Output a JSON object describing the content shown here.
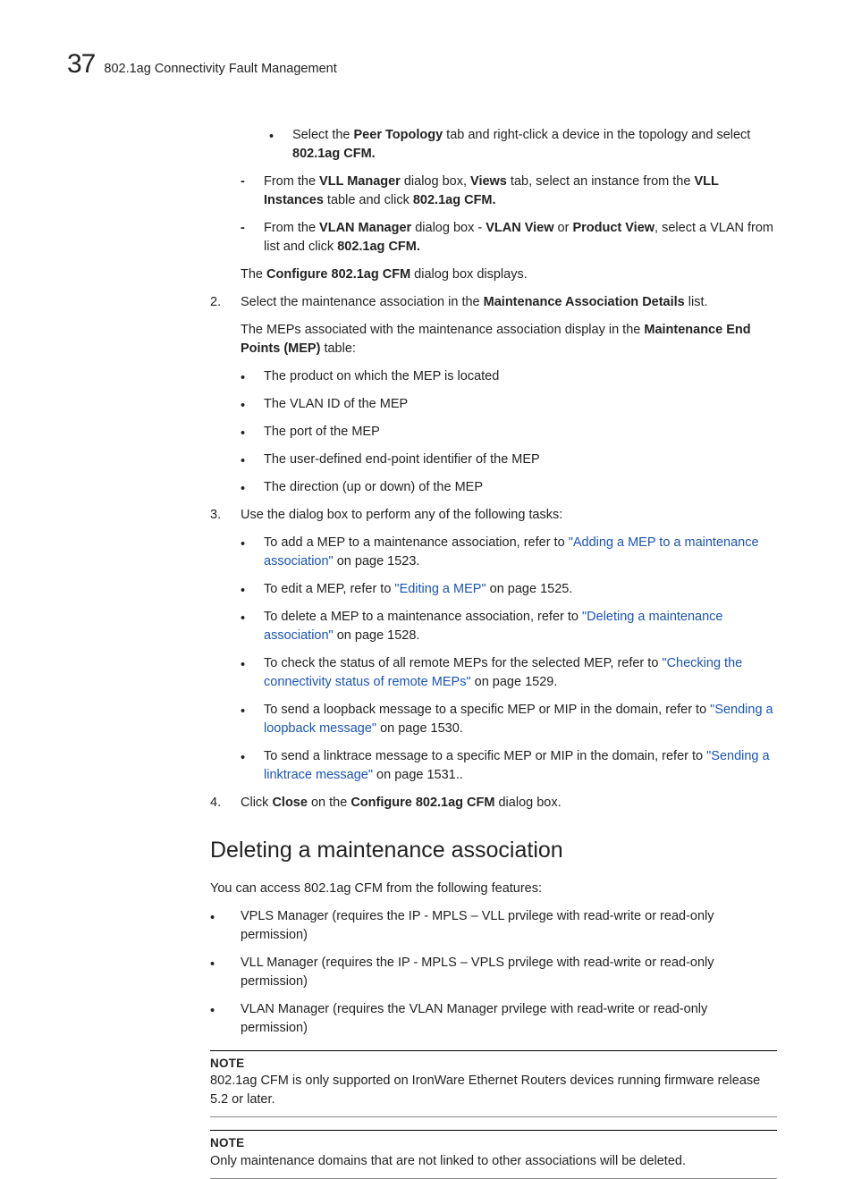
{
  "header": {
    "chapter": "37",
    "title": "802.1ag Connectivity Fault Management"
  },
  "bullet_topology_a": "Select the ",
  "bullet_topology_b": "Peer Topology",
  "bullet_topology_c": " tab and right-click a device in the topology and select ",
  "bullet_topology_d": "802.1ag CFM.",
  "dash_vll_a": "From the ",
  "dash_vll_b": "VLL Manager",
  "dash_vll_c": " dialog box, ",
  "dash_vll_d": "Views",
  "dash_vll_e": " tab, select an instance from the ",
  "dash_vll_f": "VLL Instances",
  "dash_vll_g": " table and click ",
  "dash_vll_h": "802.1ag CFM.",
  "dash_vlan_a": "From the ",
  "dash_vlan_b": "VLAN Manager",
  "dash_vlan_c": " dialog box - ",
  "dash_vlan_d": "VLAN View",
  "dash_vlan_e": " or ",
  "dash_vlan_f": "Product View",
  "dash_vlan_g": ", select a VLAN from list and click ",
  "dash_vlan_h": "802.1ag CFM.",
  "cfg_a": "The ",
  "cfg_b": "Configure 802.1ag CFM",
  "cfg_c": " dialog box displays.",
  "step2_a": "Select the maintenance association in the ",
  "step2_b": "Maintenance Association Details",
  "step2_c": " list.",
  "s2_sub_a": "The MEPs associated with the maintenance association display in the ",
  "s2_sub_b": "Maintenance End Points (MEP)",
  "s2_sub_c": " table:",
  "s2_b1": "The product on which the MEP is located",
  "s2_b2": "The VLAN ID of the MEP",
  "s2_b3": "The port of the MEP",
  "s2_b4": "The user-defined end-point identifier of the MEP",
  "s2_b5": "The direction (up or down) of the MEP",
  "step3": "Use the dialog box to perform any of the following tasks:",
  "s3_i1_a": "To add a MEP to a maintenance association, refer to ",
  "s3_i1_l": "\"Adding a MEP to a maintenance association\"",
  "s3_i1_b": " on page 1523.",
  "s3_i2_a": "To edit a MEP, refer to ",
  "s3_i2_l": "\"Editing a MEP\"",
  "s3_i2_b": " on page 1525.",
  "s3_i3_a": "To delete a MEP to a maintenance association, refer to ",
  "s3_i3_l": "\"Deleting a maintenance association\"",
  "s3_i3_b": " on page 1528.",
  "s3_i4_a": "To check the status of all remote MEPs for the selected MEP, refer to ",
  "s3_i4_l": "\"Checking the connectivity status of remote MEPs\"",
  "s3_i4_b": " on page 1529.",
  "s3_i5_a": "To send a loopback message to a specific MEP or MIP in the domain, refer to ",
  "s3_i5_l": "\"Sending a loopback message\"",
  "s3_i5_b": " on page 1530.",
  "s3_i6_a": "To send a linktrace message to a specific MEP or MIP in the domain, refer to ",
  "s3_i6_l": "\"Sending a linktrace message\"",
  "s3_i6_b": " on page 1531..",
  "step4_a": "Click ",
  "step4_b": "Close",
  "step4_c": " on the ",
  "step4_d": "Configure 802.1ag CFM",
  "step4_e": " dialog box.",
  "h2": "Deleting a maintenance association",
  "h2_intro": "You can access 802.1ag CFM from the following features:",
  "h2_b1": "VPLS Manager (requires the IP - MPLS – VLL prvilege with read-write or read-only permission)",
  "h2_b2": "VLL Manager (requires the IP - MPLS – VPLS prvilege with read-write or read-only permission)",
  "h2_b3": "VLAN Manager (requires the VLAN Manager prvilege with read-write or read-only permission)",
  "note_head": "NOTE",
  "note1": "802.1ag CFM is only supported on IronWare Ethernet Routers devices running firmware release 5.2 or later.",
  "note2": "Only maintenance domains that are not linked to other associations will be deleted.",
  "num2": "2.",
  "num3": "3.",
  "num4": "4."
}
